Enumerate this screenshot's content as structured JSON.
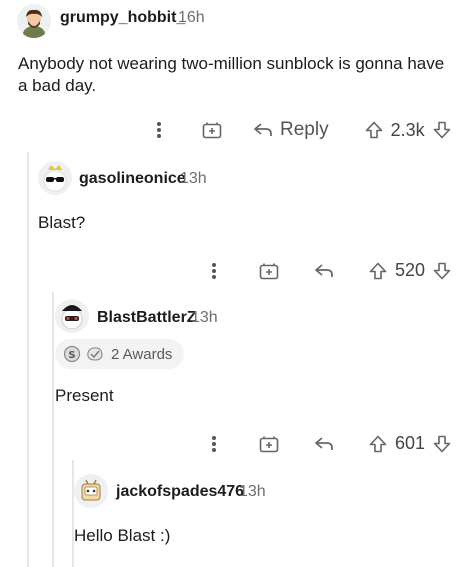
{
  "comments": [
    {
      "username": "grumpy_hobbit_",
      "time": "16h",
      "text": "Anybody not wearing two-million sunblock is gonna have a bad day.",
      "actions": {
        "reply_label": "Reply",
        "score": "2.3k"
      }
    },
    {
      "username": "gasolineonice",
      "time": "13h",
      "text": "Blast?",
      "actions": {
        "score": "520"
      }
    },
    {
      "username": "BlastBattlerZ",
      "time": "13h",
      "text": "Present",
      "awards_label": "2 Awards",
      "actions": {
        "score": "601"
      }
    },
    {
      "username": "jackofspades476",
      "time": "13h",
      "text": "Hello Blast :)"
    }
  ],
  "icons": {
    "more": "more-options-icon",
    "save": "save-icon",
    "reply": "reply-arrow-icon",
    "upvote": "upvote-icon",
    "downvote": "downvote-icon"
  },
  "colors": {
    "text": "#1c1c1c",
    "muted": "#6e6e6e",
    "thread_line": "#e6e6e6"
  }
}
